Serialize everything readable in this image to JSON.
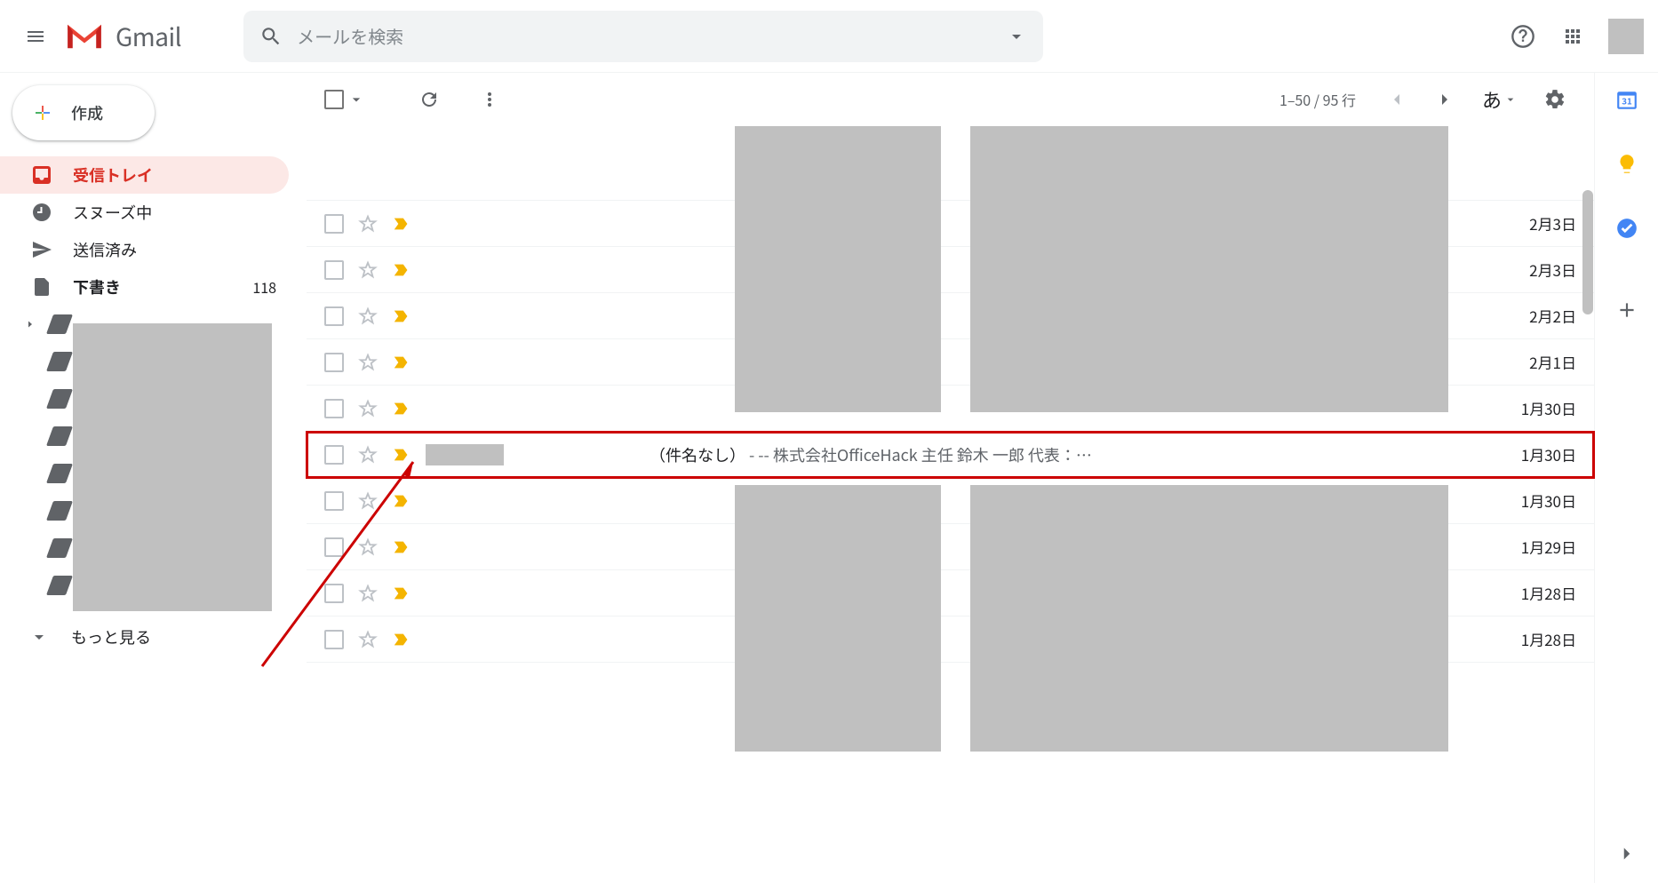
{
  "header": {
    "brand": "Gmail",
    "search_placeholder": "メールを検索"
  },
  "compose": {
    "label": "作成"
  },
  "nav": {
    "inbox": "受信トレイ",
    "snoozed": "スヌーズ中",
    "sent": "送信済み",
    "drafts": "下書き",
    "drafts_count": "118",
    "more": "もっと見る"
  },
  "toolbar": {
    "page_info": "1–50 / 95 行",
    "lang": "あ"
  },
  "rows": [
    {
      "date": "2月3日"
    },
    {
      "date": "2月3日"
    },
    {
      "date": "2月2日"
    },
    {
      "date": "2月1日"
    },
    {
      "date": "1月30日"
    },
    {
      "date": "1月30日",
      "highlighted": true,
      "subject": "（件名なし）",
      "snippet": " - -- 株式会社OfficeHack 主任 鈴木 一郎 代表：…",
      "sender_block": true
    },
    {
      "date": "1月30日"
    },
    {
      "date": "1月29日"
    },
    {
      "date": "1月28日"
    },
    {
      "date": "1月28日"
    }
  ]
}
